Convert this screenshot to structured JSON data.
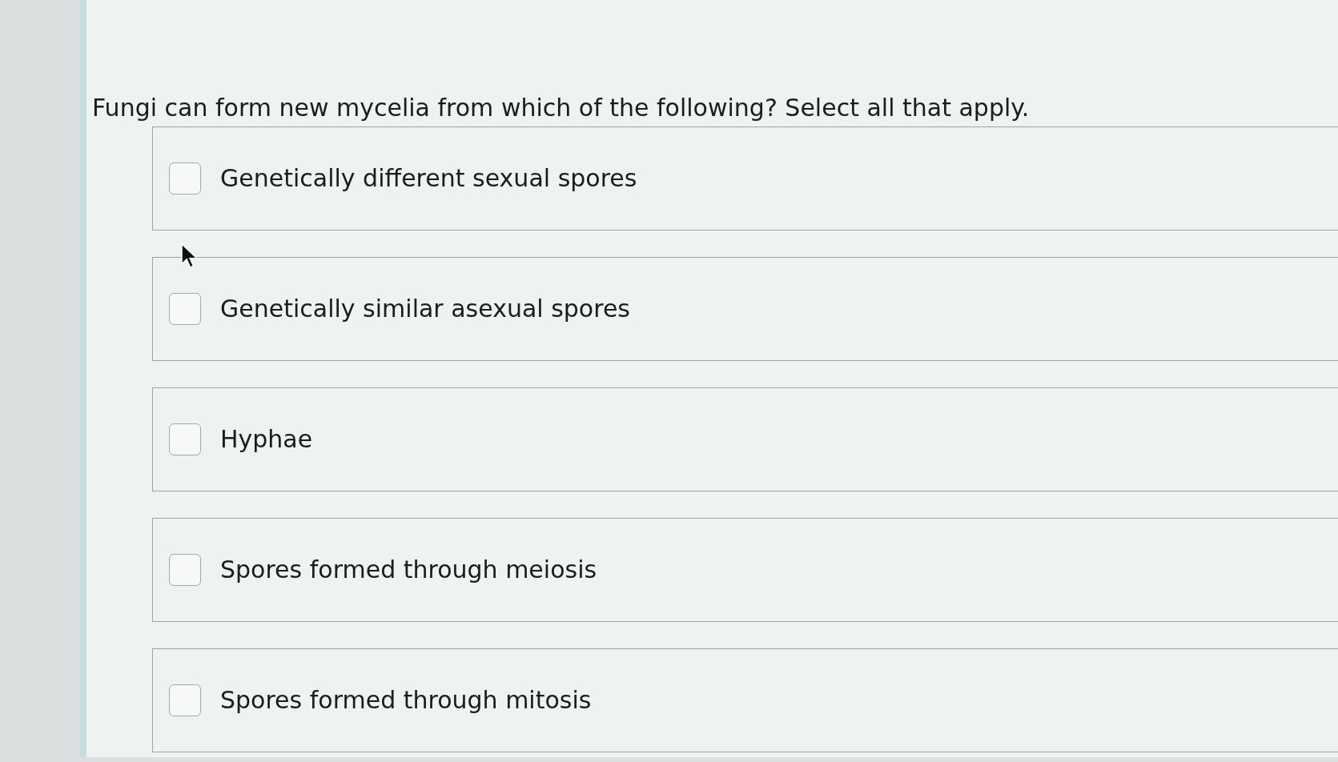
{
  "question": {
    "text": "Fungi can form new mycelia from which of the following? Select all that apply."
  },
  "options": [
    {
      "label": "Genetically different sexual spores",
      "checked": false
    },
    {
      "label": "Genetically similar asexual spores",
      "checked": false
    },
    {
      "label": "Hyphae",
      "checked": false
    },
    {
      "label": "Spores formed through meiosis",
      "checked": false
    },
    {
      "label": "Spores formed through mitosis",
      "checked": false
    }
  ]
}
